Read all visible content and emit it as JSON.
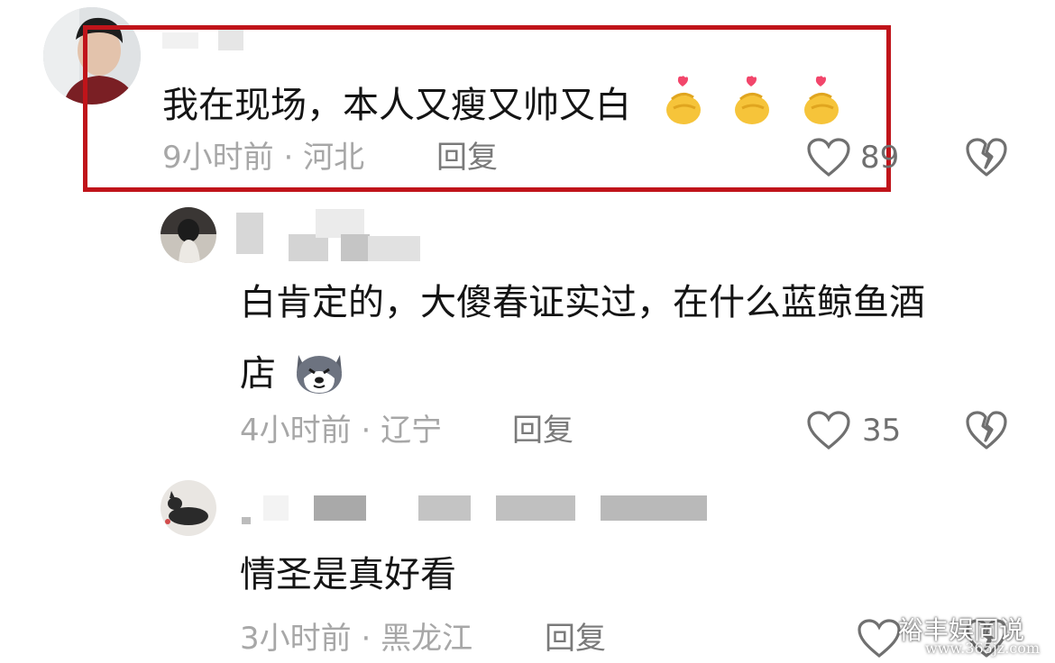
{
  "comments": [
    {
      "text": "我在现场，本人又瘦又帅又白",
      "emojis": [
        "finger-heart-emoji",
        "finger-heart-emoji",
        "finger-heart-emoji"
      ],
      "time": "9小时前",
      "location": "河北",
      "reply_label": "回复",
      "likes": "89",
      "highlighted": true
    },
    {
      "text_line1": "白肯定的，大傻春证实过，在什么蓝鲸鱼酒",
      "text_line2": "店",
      "emoji": "husky-dog-emoji",
      "time": "4小时前",
      "location": "辽宁",
      "reply_label": "回复",
      "likes": "35"
    },
    {
      "text": "情圣是真好看",
      "time": "3小时前",
      "location": "黑龙江",
      "reply_label": "回复",
      "likes": ""
    }
  ],
  "separator": " · ",
  "watermark": {
    "title": "裕丰娱同说",
    "url": "www.365jz.com"
  },
  "colors": {
    "highlight_border": "#c0141a",
    "meta_text": "#a7a7a7",
    "body_text": "#141414"
  }
}
